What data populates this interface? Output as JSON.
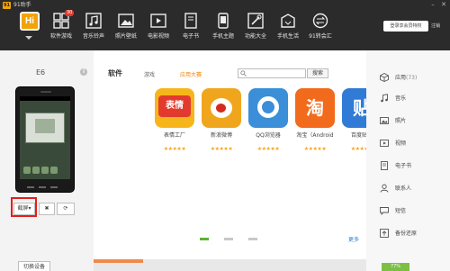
{
  "window": {
    "title": "91助手",
    "app_badge": "91",
    "minimize": "–",
    "close": "✕"
  },
  "logo": {
    "text": "Hi"
  },
  "nav": [
    {
      "label": "软件游戏",
      "icon": "apps-grid-icon",
      "badge": "30"
    },
    {
      "label": "音乐铃声",
      "icon": "music-note-icon"
    },
    {
      "label": "照片壁纸",
      "icon": "picture-icon"
    },
    {
      "label": "电影视频",
      "icon": "video-icon"
    },
    {
      "label": "电子书",
      "icon": "book-icon"
    },
    {
      "label": "手机主题",
      "icon": "theme-icon"
    },
    {
      "label": "功能大全",
      "icon": "tools-icon"
    },
    {
      "label": "手机生活",
      "icon": "shopping-bag-icon"
    },
    {
      "label": "91转会汇",
      "icon": "exchange-icon"
    }
  ],
  "header": {
    "vip_button": "登录享会员特权",
    "vip_more": "注销"
  },
  "device": {
    "name": "E6",
    "info_icon": "i",
    "screenshot_label": "截屏",
    "screenshot_arrow": "▾",
    "clear_label": "✖",
    "refresh_label": "⟳",
    "switch_label": "切换设备"
  },
  "tabs": [
    {
      "label": "软件",
      "active": true
    },
    {
      "label": "游戏"
    },
    {
      "label": "应用大赛",
      "accent": true
    }
  ],
  "search": {
    "placeholder": "",
    "button": "搜索"
  },
  "apps": [
    {
      "name": "表情工厂",
      "stars": "★★★★★",
      "color": "#f7b51c",
      "glyph": "表情"
    },
    {
      "name": "新浪微博",
      "stars": "★★★★★",
      "color": "#f0a61c",
      "glyph": "◉"
    },
    {
      "name": "QQ浏览器",
      "stars": "★★★★★",
      "color": "#3b8ed8",
      "glyph": "◯"
    },
    {
      "name": "淘宝（Android",
      "stars": "★★★★★",
      "color": "#f26a1b",
      "glyph": "淘"
    },
    {
      "name": "百度贴吧",
      "stars": "★★★★★",
      "color": "#2f7bd6",
      "glyph": "贴"
    }
  ],
  "pager": {
    "more": "更多",
    "current": 0,
    "count": 3
  },
  "progress": {
    "fraction": 0.18
  },
  "sidebar": [
    {
      "label": "应用",
      "icon": "cube-icon",
      "badge": "(73)"
    },
    {
      "label": "音乐",
      "icon": "music-note-icon"
    },
    {
      "label": "照片",
      "icon": "photo-icon"
    },
    {
      "label": "视频",
      "icon": "video-icon"
    },
    {
      "label": "电子书",
      "icon": "ebook-icon"
    },
    {
      "label": "联系人",
      "icon": "contacts-icon"
    },
    {
      "label": "短信",
      "icon": "message-icon"
    },
    {
      "label": "备份还原",
      "icon": "backup-icon"
    }
  ],
  "storage": {
    "text": "77%"
  },
  "colors": {
    "topbar": "#2b2b2b",
    "accent": "#f08300",
    "highlight": "#e0201b",
    "link": "#2a7bd3"
  }
}
